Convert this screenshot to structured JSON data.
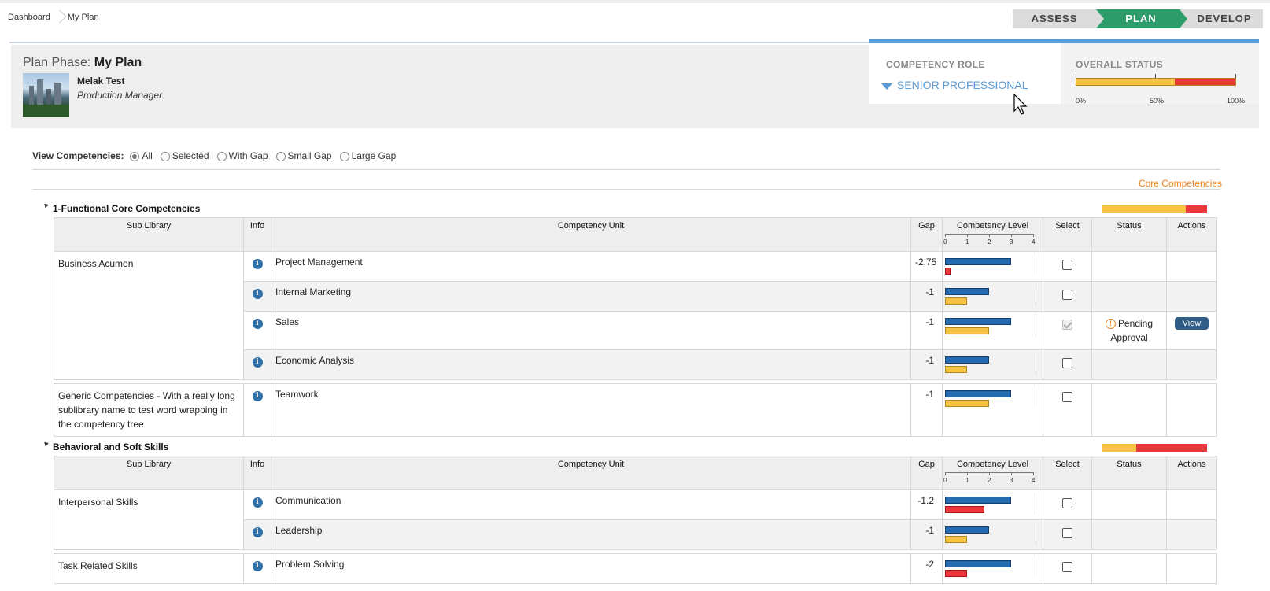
{
  "breadcrumb": [
    "Dashboard",
    "My Plan"
  ],
  "steps": [
    "ASSESS",
    "PLAN",
    "DEVELOP"
  ],
  "header": {
    "phase_prefix": "Plan Phase:",
    "phase_name": "My Plan",
    "user_name": "Melak Test",
    "user_role": "Production Manager",
    "competency_role_label": "COMPETENCY ROLE",
    "competency_role_value": "SENIOR PROFESSIONAL",
    "overall_status_label": "OVERALL STATUS",
    "overall_status_ticks": [
      "0%",
      "50%",
      "100%"
    ],
    "overall_status_red_fraction": 0.38
  },
  "filters": {
    "label": "View Competencies:",
    "options": [
      "All",
      "Selected",
      "With Gap",
      "Small Gap",
      "Large Gap"
    ],
    "selected": "All"
  },
  "core_link": "Core Competencies",
  "columns": {
    "sub_library": "Sub Library",
    "info": "Info",
    "competency_unit": "Competency Unit",
    "gap": "Gap",
    "competency_level": "Competency Level",
    "select": "Select",
    "status": "Status",
    "actions": "Actions",
    "level_ticks": [
      "0",
      "1",
      "2",
      "3",
      "4"
    ]
  },
  "groups": [
    {
      "title": "1-Functional Core Competencies",
      "bar_red_fraction": 0.2,
      "rows": [
        {
          "sub": "Business Acumen",
          "unit": "Project Management",
          "gap": "-2.75",
          "required": 3,
          "current": 0.25,
          "color": "r",
          "checked": false
        },
        {
          "sub": "",
          "unit": "Internal Marketing",
          "gap": "-1",
          "required": 2,
          "current": 1,
          "color": "y",
          "checked": false
        },
        {
          "sub": "",
          "unit": "Sales",
          "gap": "-1",
          "required": 3,
          "current": 2,
          "color": "y",
          "checked": true,
          "status": "Pending Approval",
          "action": "View"
        },
        {
          "sub": "",
          "unit": "Economic Analysis",
          "gap": "-1",
          "required": 2,
          "current": 1,
          "color": "y",
          "checked": false
        },
        {
          "sub": "Generic Competencies - With a really long sublibrary name to test word wrapping in the competency tree",
          "unit": "Teamwork",
          "gap": "-1",
          "required": 3,
          "current": 2,
          "color": "y",
          "checked": false
        }
      ]
    },
    {
      "title": "Behavioral and Soft Skills",
      "bar_red_fraction": 0.67,
      "rows": [
        {
          "sub": "Interpersonal Skills",
          "unit": "Communication",
          "gap": "-1.2",
          "required": 3,
          "current": 1.8,
          "color": "r",
          "checked": false
        },
        {
          "sub": "",
          "unit": "Leadership",
          "gap": "-1",
          "required": 2,
          "current": 1,
          "color": "y",
          "checked": false
        },
        {
          "sub": "Task Related Skills",
          "unit": "Problem Solving",
          "gap": "-2",
          "required": 3,
          "current": 1,
          "color": "r",
          "checked": false
        }
      ]
    }
  ],
  "colors": {
    "plan_active": "#2c9c6a",
    "role_accent": "#5b9bd5",
    "required_bar": "#236ab0",
    "gap_small": "#f7c244",
    "gap_large": "#e8383b",
    "link_orange": "#f0821f"
  }
}
